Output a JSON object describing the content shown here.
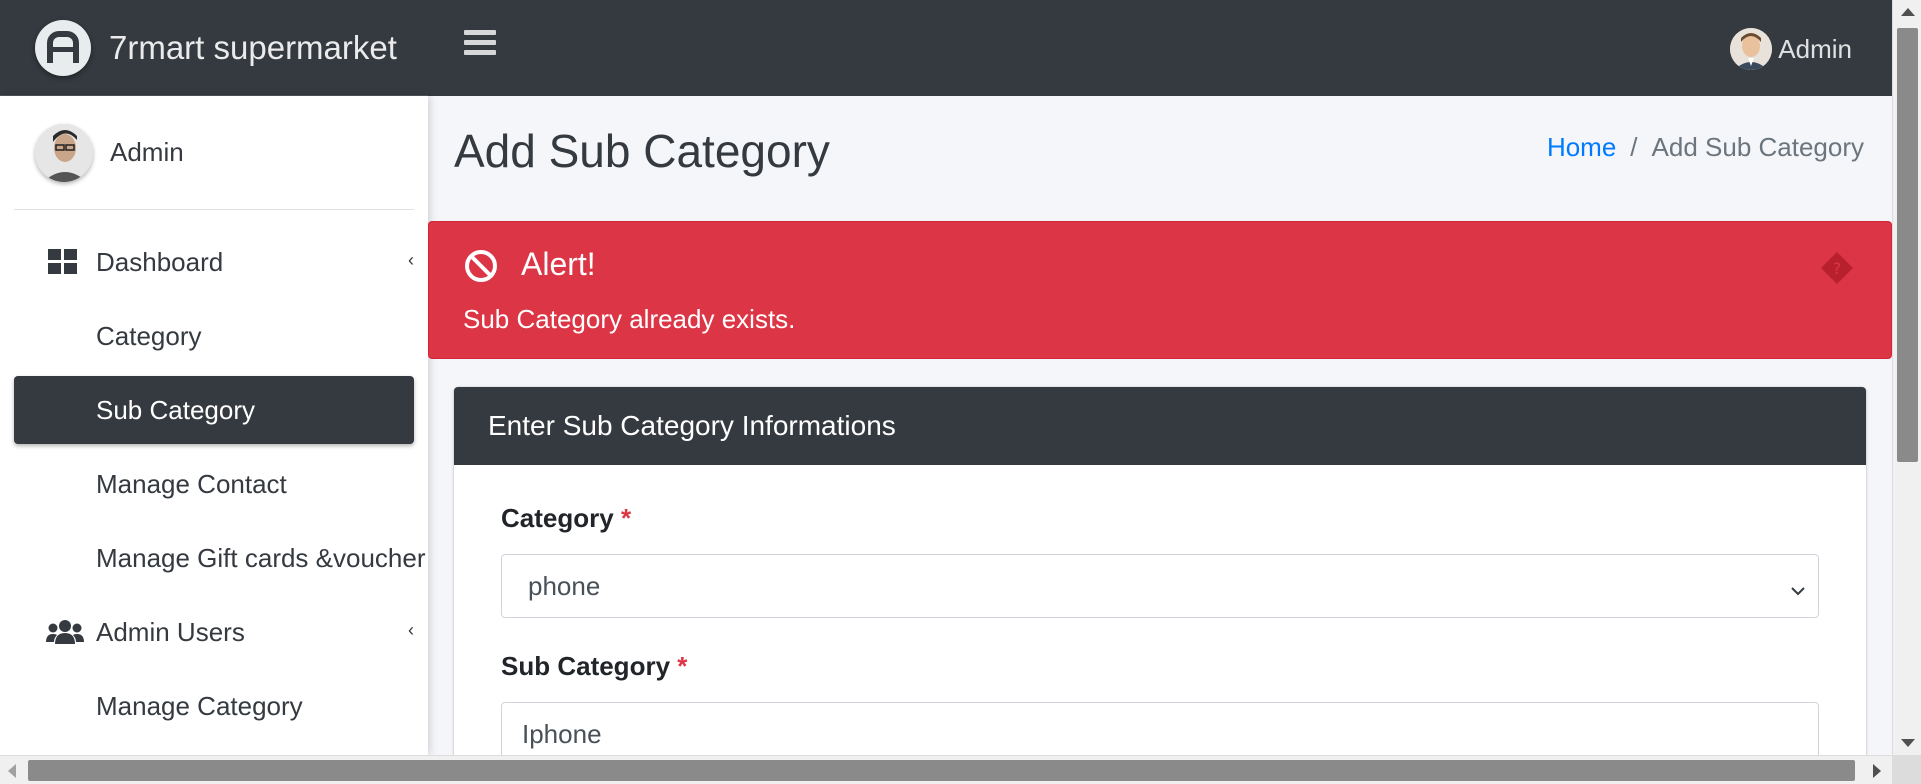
{
  "brand": {
    "name": "7rmart supermarket",
    "logo_icon": "adminlte-logo-icon"
  },
  "topbar": {
    "user_name": "Admin"
  },
  "sidebar": {
    "user_name": "Admin",
    "items": [
      {
        "label": "Dashboard",
        "icon": "dashboard-icon",
        "has_caret": true
      },
      {
        "label": "Category"
      },
      {
        "label": "Sub Category",
        "active": true
      },
      {
        "label": "Manage Contact"
      },
      {
        "label": "Manage Gift cards &voucher"
      },
      {
        "label": "Admin Users",
        "icon": "users-icon",
        "has_caret": true
      },
      {
        "label": "Manage Category"
      }
    ],
    "caret": "‹"
  },
  "page": {
    "title": "Add Sub Category",
    "breadcrumb": {
      "home": "Home",
      "separator": "/",
      "current": "Add Sub Category"
    }
  },
  "alert": {
    "title": "Alert!",
    "message": "Sub Category already exists.",
    "color": "#dc3545"
  },
  "form": {
    "header": "Enter Sub Category Informations",
    "category_label": "Category",
    "category_value": "phone",
    "subcategory_label": "Sub Category",
    "subcategory_value": "Iphone",
    "required_mark": "*"
  },
  "colors": {
    "dark": "#343a40",
    "link": "#007bff",
    "danger": "#dc3545"
  }
}
